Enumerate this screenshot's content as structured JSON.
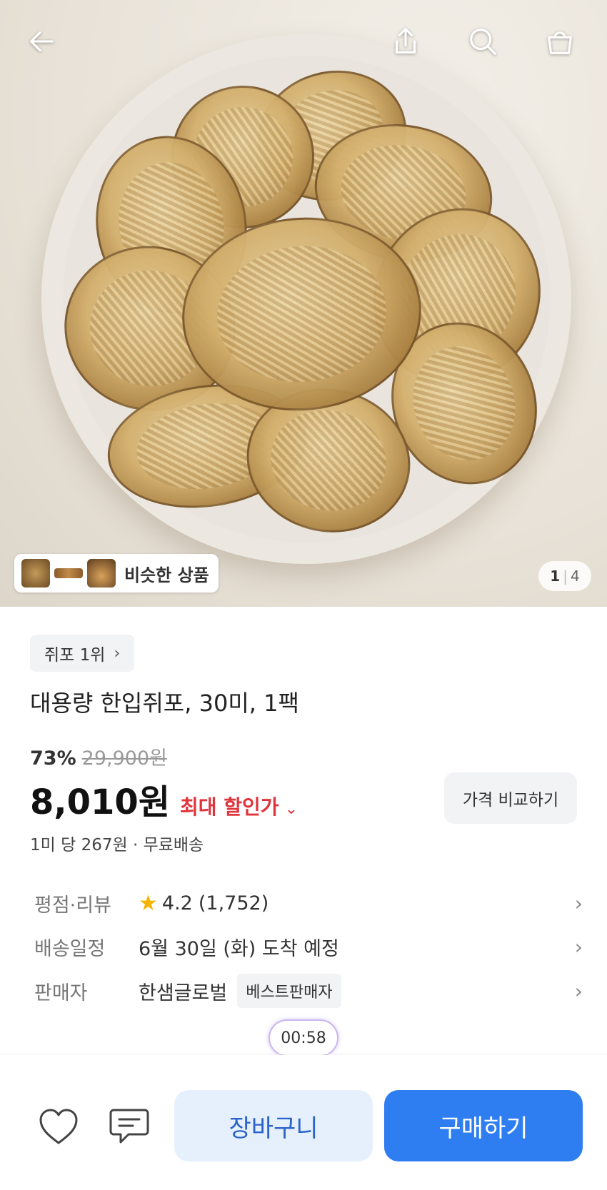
{
  "hero": {
    "pager_current": "1",
    "pager_separator": "|",
    "pager_total": "4",
    "similar_label": "비슷한 상품"
  },
  "product": {
    "rank_label": "쥐포 1위",
    "title": "대용량 한입쥐포, 30미, 1팩",
    "discount_rate": "73%",
    "original_price": "29,900원",
    "price": "8,010원",
    "max_discount_label": "최대 할인가",
    "compare_label": "가격 비교하기",
    "unit_info": "1미 당 267원 · 무료배송"
  },
  "meta": {
    "rating_key": "평점·리뷰",
    "rating_value": "4.2",
    "rating_count": "(1,752)",
    "delivery_key": "배송일정",
    "delivery_value": "6월 30일 (화) 도착 예정",
    "seller_key": "판매자",
    "seller_value": "한샘글로벌",
    "seller_badge": "베스트판매자"
  },
  "timer": "00:58",
  "bottom": {
    "cart_label": "장바구니",
    "buy_label": "구매하기"
  },
  "icons": {
    "back": "arrow-left-icon",
    "share": "share-icon",
    "search": "search-icon",
    "cart": "shopping-bag-icon",
    "wish": "heart-icon",
    "inquiry": "chat-icon",
    "star": "star-icon"
  },
  "colors": {
    "accent_red": "#e0343c",
    "buy_blue": "#2f7ef1",
    "cart_blue_bg": "#e6f0fd",
    "star": "#f6b400"
  }
}
